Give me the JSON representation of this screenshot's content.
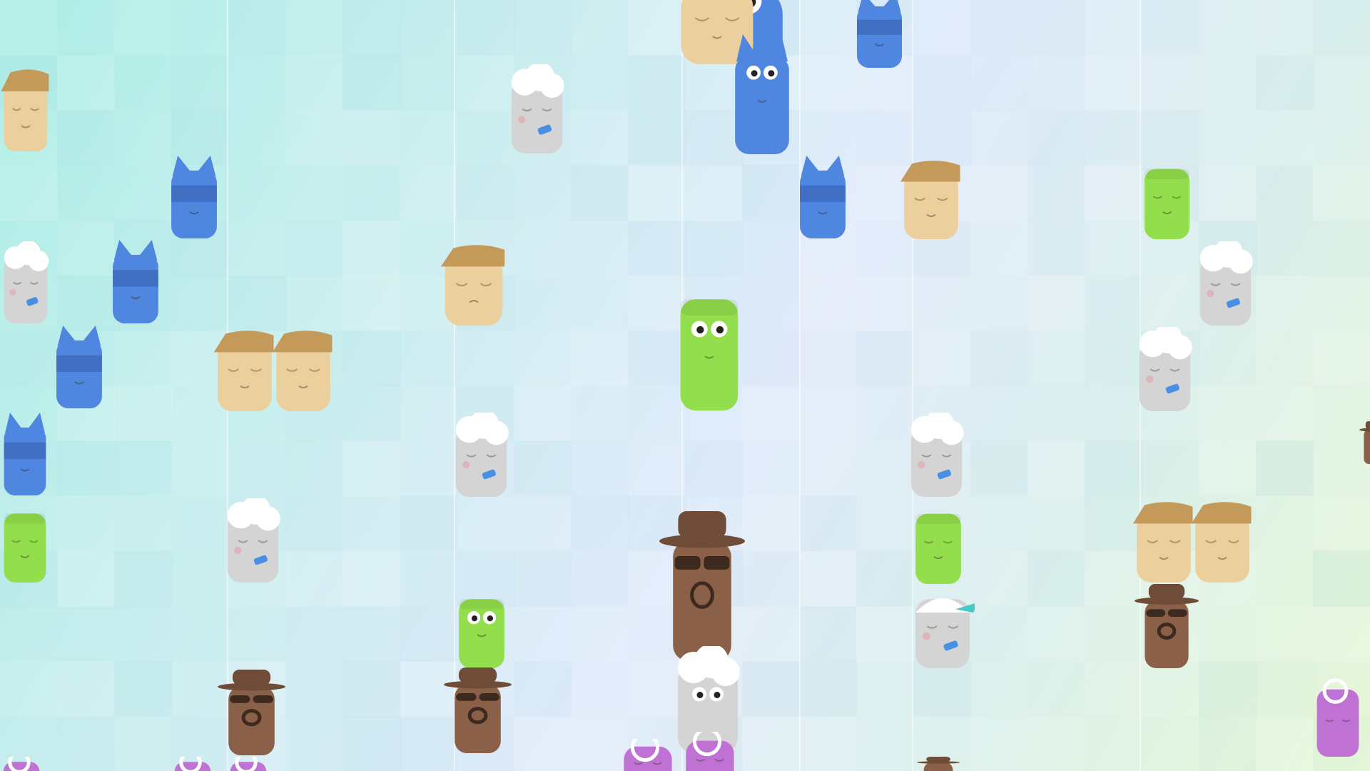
{
  "game": {
    "title": "",
    "colors": {
      "blue": "#4f86e0",
      "tan": "#ebcf9c",
      "gray": "#d4d4d4",
      "green": "#92de4c",
      "brown": "#8a6048",
      "purple": "#c071d4",
      "hat_tan": "#c49a5b",
      "hair_white": "#ffffff",
      "hat_brown": "#6f4c38",
      "glasses": "#3d2a1f",
      "cap_teal": "#47c9c5"
    },
    "characters": [
      {
        "kind": "blue-cat",
        "state": "awake",
        "color": "blue"
      },
      {
        "kind": "tan-hat",
        "state": "sleeping",
        "color": "tan"
      },
      {
        "kind": "tan-hat",
        "state": "sleeping",
        "color": "tan"
      },
      {
        "kind": "blue-cat",
        "state": "masked",
        "color": "blue"
      },
      {
        "kind": "blue-cat",
        "state": "awake",
        "color": "blue"
      },
      {
        "kind": "blue-cat",
        "state": "masked",
        "color": "blue"
      },
      {
        "kind": "gray-white-hair",
        "state": "sleeping",
        "color": "gray"
      },
      {
        "kind": "blue-cat",
        "state": "masked",
        "color": "blue"
      },
      {
        "kind": "tan-hat",
        "state": "sleeping",
        "color": "tan"
      },
      {
        "kind": "green-block",
        "state": "sleeping",
        "color": "green"
      },
      {
        "kind": "gray-white-hair",
        "state": "sleeping",
        "color": "gray"
      },
      {
        "kind": "blue-cat",
        "state": "masked",
        "color": "blue"
      },
      {
        "kind": "tan-hat",
        "state": "grumpy",
        "color": "tan"
      },
      {
        "kind": "green-block",
        "state": "awake",
        "color": "green"
      },
      {
        "kind": "gray-white-hair",
        "state": "sleeping",
        "color": "gray"
      },
      {
        "kind": "blue-cat",
        "state": "masked",
        "color": "blue"
      },
      {
        "kind": "tan-hat",
        "state": "sleeping",
        "color": "tan"
      },
      {
        "kind": "tan-hat",
        "state": "sleeping",
        "color": "tan"
      },
      {
        "kind": "gray-white-hair",
        "state": "sleeping",
        "color": "gray"
      },
      {
        "kind": "blue-cat",
        "state": "masked",
        "color": "blue"
      },
      {
        "kind": "gray-white-hair",
        "state": "sleeping",
        "color": "gray"
      },
      {
        "kind": "gray-white-hair",
        "state": "sleeping",
        "color": "gray"
      },
      {
        "kind": "green-block",
        "state": "sleeping",
        "color": "green"
      },
      {
        "kind": "gray-white-hair",
        "state": "sleeping",
        "color": "gray"
      },
      {
        "kind": "brown-fedora",
        "state": "glasses",
        "color": "brown"
      },
      {
        "kind": "green-block",
        "state": "sleeping",
        "color": "green"
      },
      {
        "kind": "tan-hat",
        "state": "sleeping",
        "color": "tan"
      },
      {
        "kind": "tan-hat",
        "state": "sleeping",
        "color": "tan"
      },
      {
        "kind": "green-block",
        "state": "awake",
        "color": "green"
      },
      {
        "kind": "gray-cap",
        "state": "sleeping",
        "color": "gray"
      },
      {
        "kind": "brown-fedora",
        "state": "glasses",
        "color": "brown"
      },
      {
        "kind": "brown-fedora",
        "state": "glasses",
        "color": "brown"
      },
      {
        "kind": "brown-fedora",
        "state": "glasses",
        "color": "brown"
      },
      {
        "kind": "gray-white-hair",
        "state": "awake",
        "color": "gray"
      },
      {
        "kind": "purple-goggles",
        "state": "sleeping",
        "color": "purple"
      },
      {
        "kind": "purple-goggles",
        "state": "partial",
        "color": "purple"
      },
      {
        "kind": "purple-goggles",
        "state": "partial",
        "color": "purple"
      },
      {
        "kind": "purple-goggles",
        "state": "partial",
        "color": "purple"
      },
      {
        "kind": "purple-goggles",
        "state": "partial",
        "color": "purple"
      },
      {
        "kind": "purple-goggles",
        "state": "partial",
        "color": "purple"
      },
      {
        "kind": "brown-fedora",
        "state": "partial",
        "color": "brown"
      },
      {
        "kind": "brown-fedora",
        "state": "partial",
        "color": "brown"
      }
    ]
  }
}
